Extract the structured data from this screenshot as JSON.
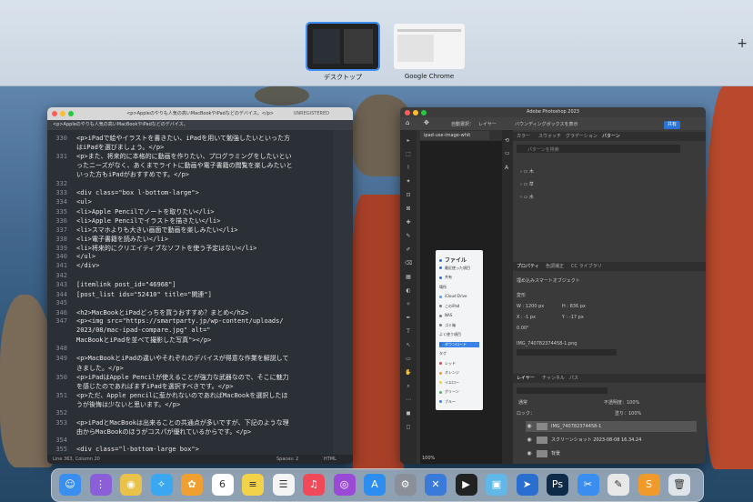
{
  "mission_control": {
    "spaces": [
      {
        "label": "デスクトップ",
        "active": true
      },
      {
        "label": "Google Chrome",
        "active": false
      }
    ],
    "add_space": "+"
  },
  "editor": {
    "title": "<p>Appleのやりも人気の高いMacBookやiPadなどのデバイス。</p>",
    "tab": "<p>Appleのやりも人気の高いMacBookやiPadなどのデバイス。",
    "unregistered": "UNREGISTERED",
    "lines": [
      {
        "n": "330",
        "text": "<p>iPadで絵やイラストを書きたい、iPadを用いて勉強したいといった方"
      },
      {
        "n": "",
        "text": "はiPadを選びましょう。</p>"
      },
      {
        "n": "331",
        "text": "<p>また、将来的に本格的に動画を作りたい、プログラミングをしたいとい"
      },
      {
        "n": "",
        "text": "ったニーズがなく、あくまでライトに動画や電子書籍の閲覧を楽しみたいと"
      },
      {
        "n": "",
        "text": "いった方もiPadがおすすめです。</p>"
      },
      {
        "n": "332",
        "text": ""
      },
      {
        "n": "333",
        "text": "<div class=\"box l-bottom-large\">"
      },
      {
        "n": "334",
        "text": "<ul>"
      },
      {
        "n": "335",
        "text": "<li>Apple Pencilでノートを取りたい</li>"
      },
      {
        "n": "336",
        "text": "<li>Apple Pencilでイラストを描きたい</li>"
      },
      {
        "n": "337",
        "text": "<li>スマホよりも大きい画面で動画を楽しみたい</li>"
      },
      {
        "n": "338",
        "text": "<li>電子書籍を読みたい</li>"
      },
      {
        "n": "339",
        "text": "<li>将来的にクリエイティブなソフトを使う予定はない</li>"
      },
      {
        "n": "340",
        "text": "</ul>"
      },
      {
        "n": "341",
        "text": "</div>"
      },
      {
        "n": "342",
        "text": ""
      },
      {
        "n": "343",
        "text": "[itemlink post_id=\"46968\"]"
      },
      {
        "n": "344",
        "text": "[post_list ids=\"52410\" title=\"関連\"]"
      },
      {
        "n": "345",
        "text": ""
      },
      {
        "n": "346",
        "text": "<h2>MacBookとiPadどっちを買うおすすめ？まとめ</h2>"
      },
      {
        "n": "347",
        "text": "<p><img src=\"https://smartparty.jp/wp-content/uploads/"
      },
      {
        "n": "",
        "text": "2023/08/mac-ipad-compare.jpg\" alt=\""
      },
      {
        "n": "",
        "text": "MacBookとiPadを並べて撮影した写真\"></p>"
      },
      {
        "n": "348",
        "text": ""
      },
      {
        "n": "349",
        "text": "<p>MacBookとiPadの違いやそれぞれのデバイスが得意な作業を解説して"
      },
      {
        "n": "",
        "text": "きました。</p>"
      },
      {
        "n": "350",
        "text": "<p>iPadはApple Pencilが使えることが強力な武器なので、そこに魅力"
      },
      {
        "n": "",
        "text": "を感じたのであればまずiPadを選択すべきです。</p>"
      },
      {
        "n": "351",
        "text": "<p>ただ、Apple pencilに惹かれないのであればMacBookを選択したほ"
      },
      {
        "n": "",
        "text": "うが後悔は少ないと思います。</p>"
      },
      {
        "n": "352",
        "text": ""
      },
      {
        "n": "353",
        "text": "<p>iPadとMacBookは出来ることの共通点が多いですが、下記のような理"
      },
      {
        "n": "",
        "text": "由からMacBookのほうがコスパが優れているからです。</p>"
      },
      {
        "n": "354",
        "text": ""
      },
      {
        "n": "355",
        "text": "<div class=\"l-bottom-large box\">"
      },
      {
        "n": "356",
        "text": "<ul>"
      }
    ],
    "status_left": "Line 363, Column 20",
    "status_mid": "Spaces: 2",
    "status_right": "HTML"
  },
  "photoshop": {
    "title": "Adobe Photoshop 2023",
    "options": {
      "auto_select": "自動選択：",
      "layer": "レイヤー",
      "bbox": "バウンディングボックスを表示",
      "share": "共有"
    },
    "doc_tab": "ipad-use-image-whit",
    "image_menu": [
      {
        "text": "ファイル",
        "dot": "#2b6fd6"
      },
      {
        "text": "最近使った項目",
        "dot": "#2b6fd6"
      },
      {
        "text": "共有",
        "dot": "#2b6fd6"
      },
      {
        "text": "場所",
        "dot": ""
      },
      {
        "text": "iCloud Drive",
        "dot": "#4aa3f0"
      },
      {
        "text": "このiPad",
        "dot": "#777"
      },
      {
        "text": "NAS",
        "dot": "#777"
      },
      {
        "text": "ゴミ箱",
        "dot": "#777"
      },
      {
        "text": "よく使う項目",
        "dot": ""
      },
      {
        "text": "ダウンロード",
        "dot": "#2b6fd6"
      },
      {
        "text": "タグ",
        "dot": ""
      },
      {
        "text": "レッド",
        "dot": "#e0443c"
      },
      {
        "text": "オレンジ",
        "dot": "#f09a2c"
      },
      {
        "text": "イエロー",
        "dot": "#f2cf3c"
      },
      {
        "text": "グリーン",
        "dot": "#4cb84c"
      },
      {
        "text": "ブルー",
        "dot": "#3a82e8"
      }
    ],
    "zoom": "100%",
    "panel_tabs_top": [
      "カラー",
      "スウォッチ",
      "グラデーション",
      "パターン"
    ],
    "pattern_search": "パターンを検索",
    "pattern_folders": [
      "木",
      "草",
      "水"
    ],
    "props_tabs": [
      "プロパティ",
      "色調補正",
      "CC ライブラリ"
    ],
    "props_title": "埋め込みスマートオブジェクト",
    "props_section": "変形",
    "w": "W : 1200 px",
    "h": "H : 836 px",
    "x": "X : -1 px",
    "y": "Y : -17 px",
    "angle": "0.00°",
    "file": "IMG_740782374458-1.png",
    "layers_tabs": [
      "レイヤー",
      "チャンネル",
      "パス"
    ],
    "blend": "通常",
    "opacity": "不透明度：100%",
    "lock": "ロック：",
    "fill": "塗り：100%",
    "layers": [
      {
        "name": "IMG_740782374458-1",
        "selected": true
      },
      {
        "name": "スクリーンショット 2023-08-08 16.34.24",
        "selected": false
      },
      {
        "name": "背景",
        "selected": false
      }
    ]
  },
  "dock": {
    "apps": [
      {
        "name": "Finder",
        "glyph": "☺",
        "color": "#3a8ef0"
      },
      {
        "name": "Launchpad",
        "glyph": "⋮",
        "color": "#8a5fd8"
      },
      {
        "name": "Chrome",
        "glyph": "◉",
        "color": "#e8c24a"
      },
      {
        "name": "Safari",
        "glyph": "✧",
        "color": "#3aa7f0"
      },
      {
        "name": "Photos",
        "glyph": "✿",
        "color": "#f0a030"
      },
      {
        "name": "Calendar",
        "glyph": "6",
        "color": "#ffffff"
      },
      {
        "name": "Notes",
        "glyph": "≡",
        "color": "#f2d24a"
      },
      {
        "name": "Reminders",
        "glyph": "☰",
        "color": "#f4f4f4"
      },
      {
        "name": "Music",
        "glyph": "♫",
        "color": "#f04a5a"
      },
      {
        "name": "Podcasts",
        "glyph": "◎",
        "color": "#9b4ad8"
      },
      {
        "name": "App Store",
        "glyph": "A",
        "color": "#2e8ef0"
      },
      {
        "name": "Settings",
        "glyph": "⚙",
        "color": "#8a8f98"
      },
      {
        "name": "Xcode",
        "glyph": "✕",
        "color": "#3a7ad8"
      },
      {
        "name": "Final Cut",
        "glyph": "▶",
        "color": "#222222"
      },
      {
        "name": "Preview",
        "glyph": "▣",
        "color": "#5fb8e8"
      },
      {
        "name": "Xcode2",
        "glyph": "➤",
        "color": "#2a6fd0"
      },
      {
        "name": "Photoshop",
        "glyph": "Ps",
        "color": "#0f2b4a"
      },
      {
        "name": "Scissors",
        "glyph": "✂",
        "color": "#3a8ef0"
      },
      {
        "name": "TextEdit",
        "glyph": "✎",
        "color": "#e8e8e8"
      },
      {
        "name": "Sublime",
        "glyph": "S",
        "color": "#f09a2c"
      },
      {
        "name": "Trash",
        "glyph": "🗑",
        "color": "#dfe4ea"
      }
    ]
  }
}
